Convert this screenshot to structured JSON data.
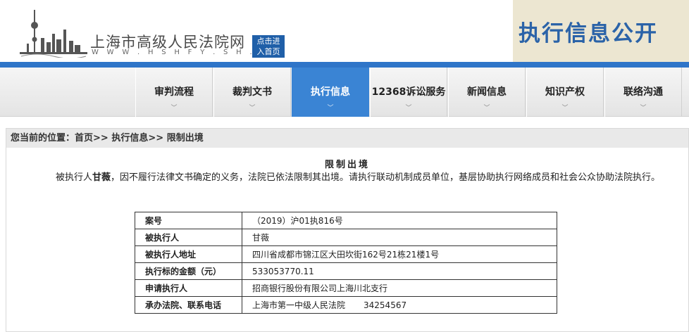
{
  "header": {
    "site_title": "上海市高级人民法院网",
    "site_url": "W W W . H S H F Y . S H . C N",
    "home_button": [
      "点击进",
      "入首页"
    ],
    "banner_title": "执行信息公开",
    "colors": {
      "accent": "#2f75c8",
      "banner_bg": "#ece6d1",
      "banner_text": "#2b63a8"
    }
  },
  "nav": {
    "items": [
      {
        "label": "审判流程",
        "active": false
      },
      {
        "label": "裁判文书",
        "active": false
      },
      {
        "label": "执行信息",
        "active": true
      },
      {
        "label": "12368诉讼服务",
        "active": false
      },
      {
        "label": "新闻信息",
        "active": false
      },
      {
        "label": "知识产权",
        "active": false
      },
      {
        "label": "联络沟通",
        "active": false
      }
    ],
    "chevron": "﹀"
  },
  "breadcrumb": {
    "prefix": "您当前的位置：",
    "crumbs": [
      "首页",
      "执行信息",
      "限制出境"
    ],
    "separator": ">>"
  },
  "notice": {
    "title": "限制出境",
    "body_pre": "被执行人",
    "person": "甘薇",
    "body_post": "，因不履行法律文书确定的义务，法院已依法限制其出境。请执行联动机制成员单位，基层协助执行网络成员和社会公众协助法院执行。"
  },
  "table": {
    "rows": [
      {
        "key": "案号",
        "value": "（2019）沪01执816号"
      },
      {
        "key": "被执行人",
        "value": "甘薇"
      },
      {
        "key": "被执行人地址",
        "value": "四川省成都市锦江区大田坎街162号21栋21楼1号"
      },
      {
        "key": "执行标的金额（元）",
        "value": "533053770.11"
      },
      {
        "key": "申请执行人",
        "value": "招商银行股份有限公司上海川北支行"
      },
      {
        "key": "承办法院、联系电话",
        "value": "上海市第一中级人民法院",
        "tel": "34254567"
      }
    ]
  }
}
